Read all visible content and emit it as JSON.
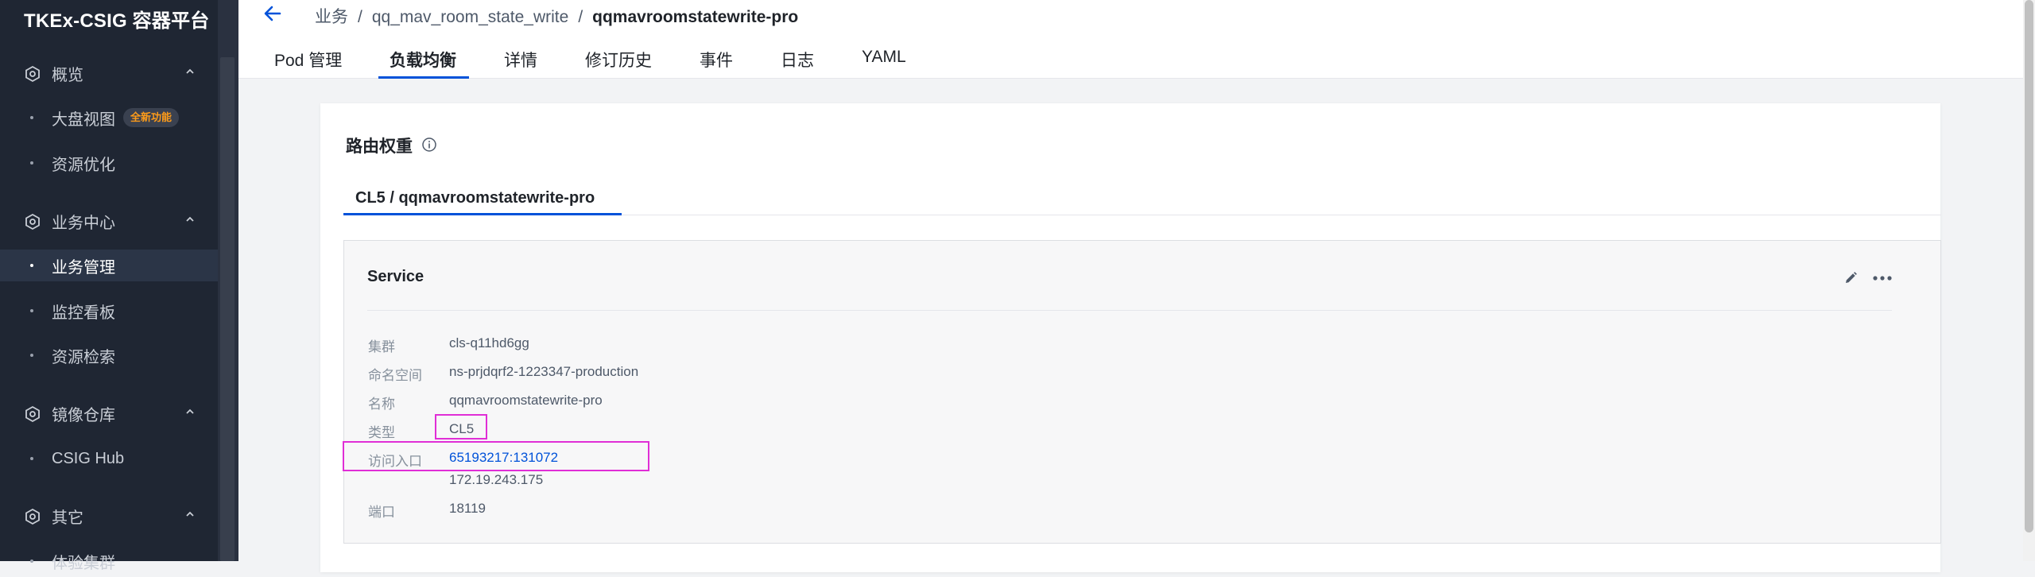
{
  "app": {
    "brand": "TKEx-CSIG 容器平台"
  },
  "sidebar": {
    "groups": [
      {
        "label": "概览",
        "items": [
          {
            "label": "大盘视图",
            "badge": "全新功能"
          },
          {
            "label": "资源优化"
          }
        ]
      },
      {
        "label": "业务中心",
        "items": [
          {
            "label": "业务管理",
            "active": true
          },
          {
            "label": "监控看板"
          },
          {
            "label": "资源检索"
          }
        ]
      },
      {
        "label": "镜像仓库",
        "items": [
          {
            "label": "CSIG Hub"
          }
        ]
      },
      {
        "label": "其它",
        "items": [
          {
            "label": "体验集群"
          }
        ]
      }
    ]
  },
  "breadcrumb": {
    "root": "业务",
    "separator": "/",
    "parent": "qq_mav_room_state_write",
    "current": "qqmavroomstatewrite-pro"
  },
  "tabs": [
    "Pod 管理",
    "负载均衡",
    "详情",
    "修订历史",
    "事件",
    "日志",
    "YAML"
  ],
  "active_tab": "负载均衡",
  "section": {
    "title": "路由权重",
    "subtab": "CL5 / qqmavroomstatewrite-pro"
  },
  "service": {
    "title": "Service",
    "fields": {
      "cluster": {
        "label": "集群",
        "value": "cls-q11hd6gg"
      },
      "namespace": {
        "label": "命名空间",
        "value": "ns-prjdqrf2-1223347-production"
      },
      "name": {
        "label": "名称",
        "value": "qqmavroomstatewrite-pro"
      },
      "type": {
        "label": "类型",
        "value": "CL5"
      },
      "access": {
        "label": "访问入口",
        "link": "65193217:131072",
        "ip": "172.19.243.175"
      },
      "port": {
        "label": "端口",
        "value": "18119"
      }
    }
  },
  "colors": {
    "accent": "#0052d9",
    "highlight": "#e02ed6",
    "badge_text": "#ff9c19",
    "sidebar_bg": "#1f2633"
  }
}
